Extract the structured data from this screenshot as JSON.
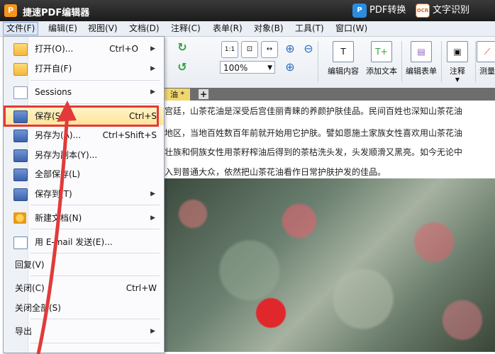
{
  "titlebar": {
    "app_icon": "P",
    "title": "捷速PDF编辑器",
    "pdf_convert": "PDF转换",
    "ocr_icon": "OCR",
    "ocr_label": "文字识别"
  },
  "menubar": [
    "文件(F)",
    "编辑(E)",
    "视图(V)",
    "文档(D)",
    "注释(C)",
    "表单(R)",
    "对象(B)",
    "工具(T)",
    "窗口(W)"
  ],
  "toolbar": {
    "zoom_value": "100%",
    "edit_content": "编辑内容",
    "add_text": "添加文本",
    "edit_form": "编辑表单",
    "annotate": "注释",
    "measure": "测量"
  },
  "doc": {
    "tab_label": "油 *",
    "new_tab": "+",
    "lines": [
      "宫廷，山茶花油是深受后宫佳丽青睐的养颜护肤佳品。民间百姓也深知山茶花油",
      "地区，当地百姓数百年前就开始用它护肤。譬如恩施土家族女性喜欢用山茶花油",
      "壮族和侗族女性用茶籽榨油后得到的茶枯洗头发，头发顺滑又黑亮。如今无论中",
      "入到普通大众，依然把山茶花油看作日常护肤护发的佳品。"
    ]
  },
  "file_menu": {
    "open": {
      "label": "打开(O)...",
      "shortcut": "Ctrl+O"
    },
    "open_from": {
      "label": "打开自(F)"
    },
    "sessions": {
      "label": "Sessions"
    },
    "save": {
      "label": "保存(S)",
      "shortcut": "Ctrl+S"
    },
    "save_as": {
      "label": "另存为(A)...",
      "shortcut": "Ctrl+Shift+S"
    },
    "save_copy": {
      "label": "另存为副本(Y)..."
    },
    "save_all": {
      "label": "全部保存(L)"
    },
    "save_to": {
      "label": "保存到(T)"
    },
    "new_doc": {
      "label": "新建文档(N)"
    },
    "email": {
      "label": "用 E-mail 发送(E)..."
    },
    "revert": {
      "label": "回复(V)"
    },
    "close": {
      "label": "关闭(C)",
      "shortcut": "Ctrl+W"
    },
    "close_all": {
      "label": "关闭全部(S)"
    },
    "export": {
      "label": "导出"
    }
  },
  "colors": {
    "highlight_box": "#e23a3a",
    "arrow": "#e23a3a"
  }
}
